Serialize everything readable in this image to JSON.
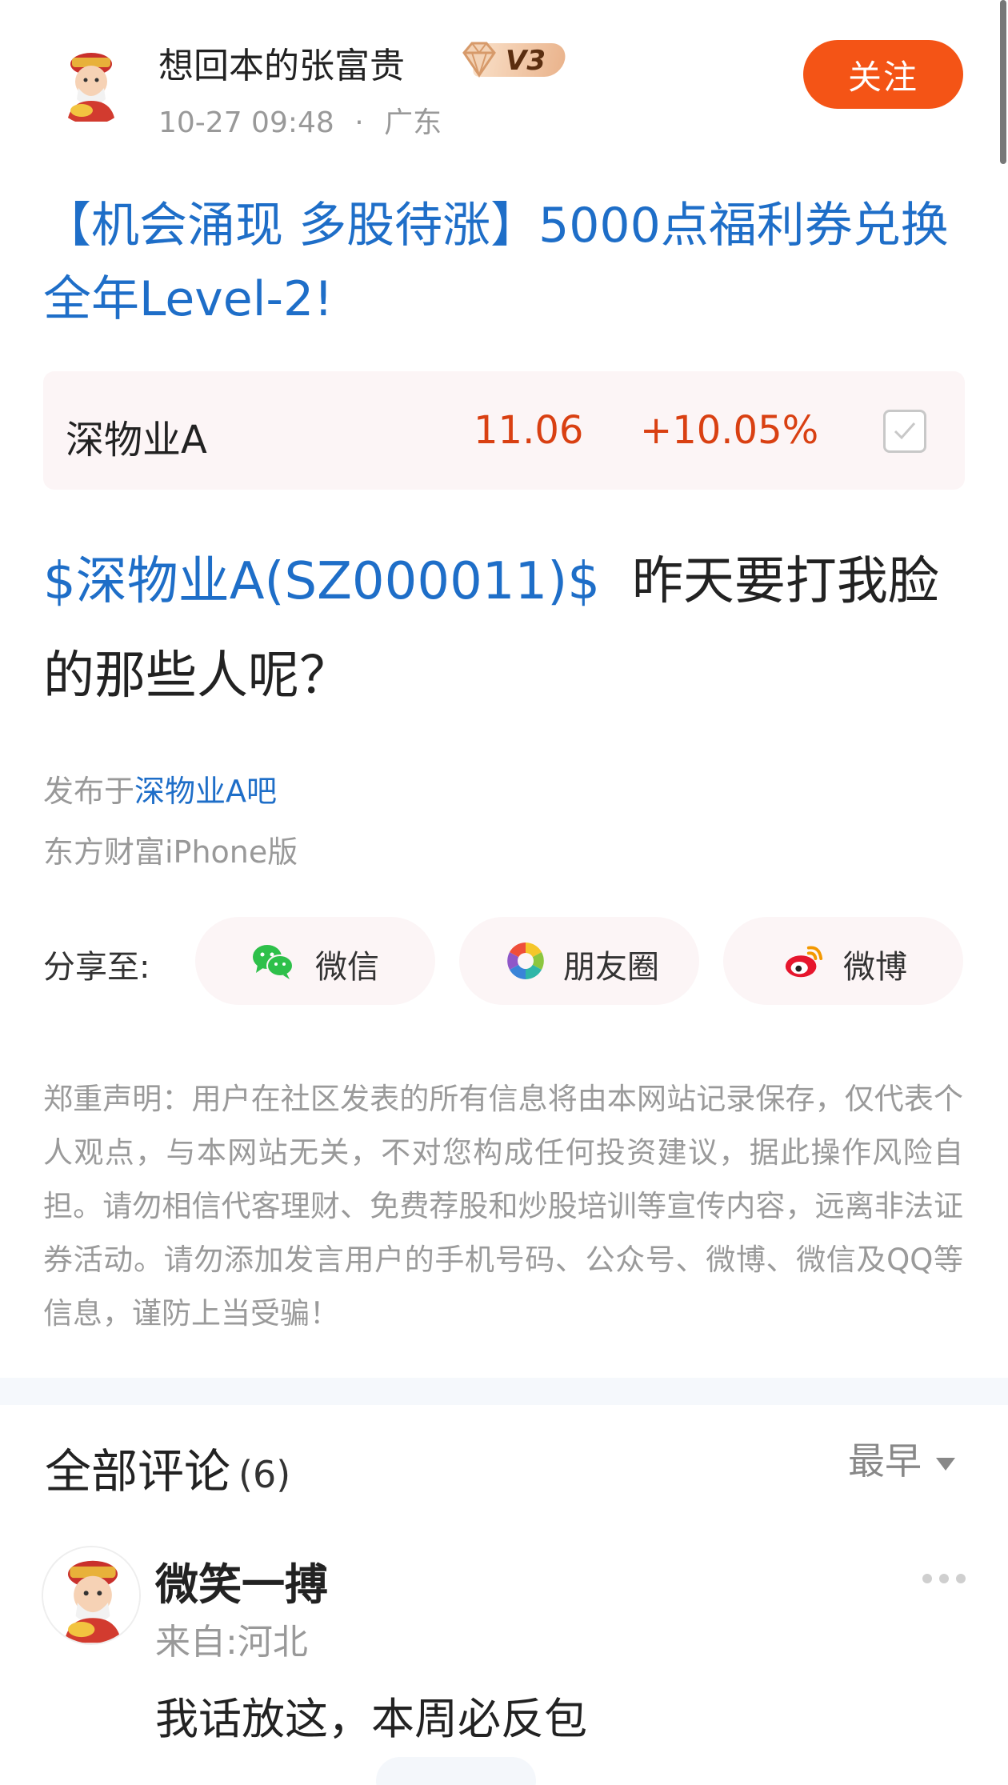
{
  "header": {
    "author_name": "想回本的张富贵",
    "vip_level": "V3",
    "post_time": "10-27 09:48",
    "separator": "·",
    "location": "广东",
    "follow_label": "关注"
  },
  "post": {
    "title": "【机会涌现 多股待涨】5000点福利券兑换全年Level-2!",
    "stock_card": {
      "name": "深物业A",
      "price": "11.06",
      "change": "+10.05%",
      "colors": {
        "up": "#d94012"
      }
    },
    "body_stock_link": "$深物业A(SZ000011)$",
    "body_text": "昨天要打我脸的那些人呢？",
    "published_prefix": "发布于",
    "published_bar": "深物业A吧",
    "client": "东方财富iPhone版"
  },
  "share": {
    "label": "分享至:",
    "targets": [
      {
        "label": "微信",
        "icon": "wechat-icon"
      },
      {
        "label": "朋友圈",
        "icon": "moments-icon"
      },
      {
        "label": "微博",
        "icon": "weibo-icon"
      }
    ]
  },
  "disclaimer": "郑重声明：用户在社区发表的所有信息将由本网站记录保存，仅代表个人观点，与本网站无关，不对您构成任何投资建议，据此操作风险自担。请勿相信代客理财、免费荐股和炒股培训等宣传内容，远离非法证券活动。请勿添加发言用户的手机号码、公众号、微博、微信及QQ等信息，谨防上当受骗！",
  "comments": {
    "title": "全部评论",
    "count": "(6)",
    "sort_label": "最早",
    "items": [
      {
        "user": "微笑一搏",
        "location": "来自:河北",
        "text": "我话放这，本周必反包"
      }
    ]
  },
  "theme": {
    "accent": "#f45416",
    "link": "#1e6ec8",
    "muted": "#999999"
  }
}
